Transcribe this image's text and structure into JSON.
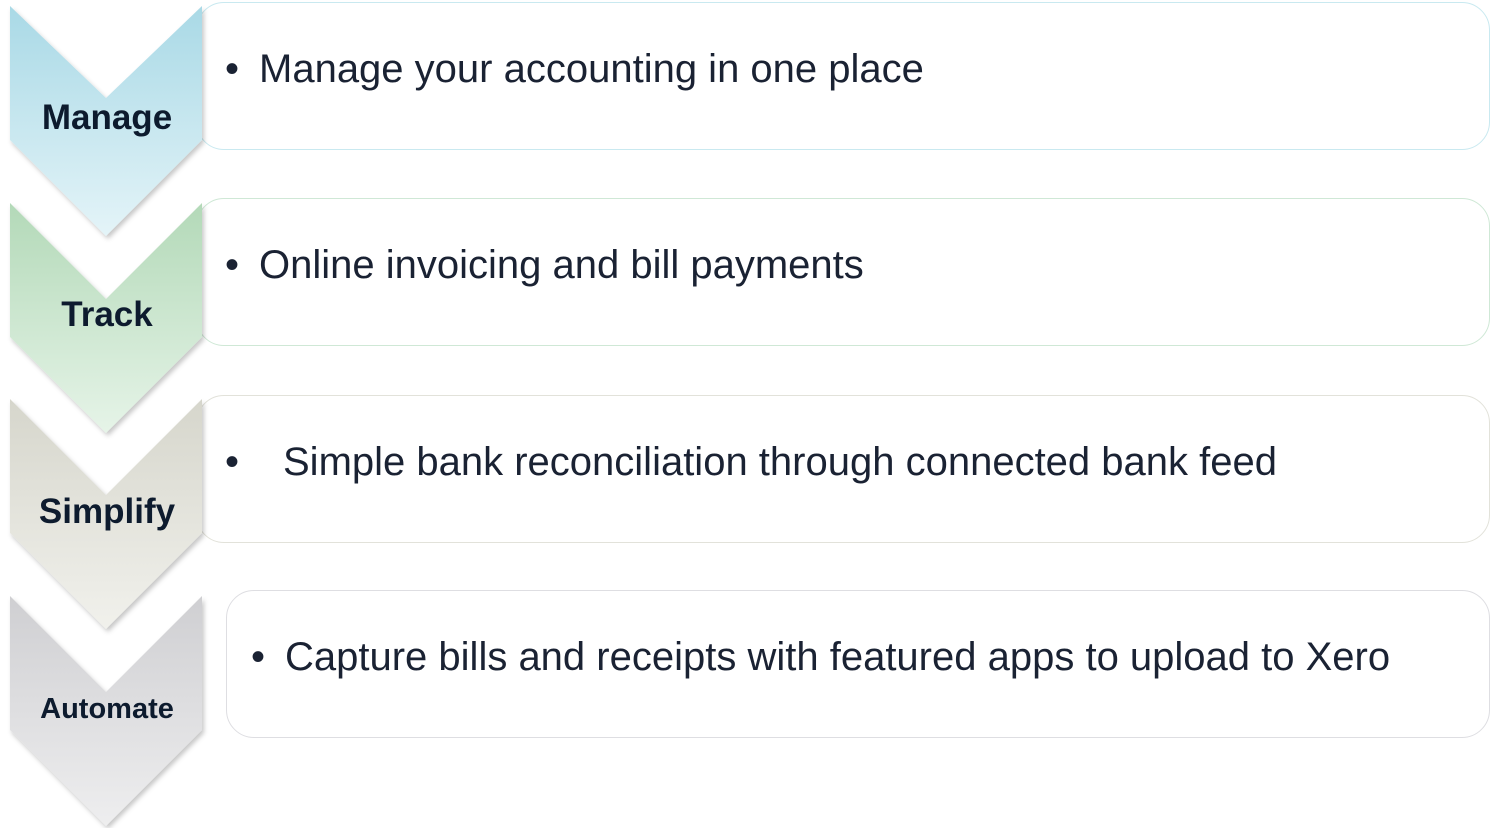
{
  "steps": [
    {
      "label": "Manage",
      "text": "Manage your accounting in one place",
      "bullet": "•",
      "color_top": "#a9d9e6",
      "color_bottom": "#e4f4f8",
      "border": "#c9e9f0"
    },
    {
      "label": "Track",
      "text": "Online invoicing and bill payments",
      "bullet": "•",
      "color_top": "#b3d9b8",
      "color_bottom": "#e6f4e8",
      "border": "#cfe8d6"
    },
    {
      "label": "Simplify",
      "text": "Simple bank reconciliation through connected bank feed",
      "bullet": "•",
      "color_top": "#d6d6cc",
      "color_bottom": "#f1f1ec",
      "border": "#e2e2da"
    },
    {
      "label": "Automate",
      "text": "Capture bills and receipts with featured apps to upload to Xero",
      "bullet": "•",
      "color_top": "#cfcfd2",
      "color_bottom": "#eeeeef",
      "border": "#dedee2"
    }
  ]
}
